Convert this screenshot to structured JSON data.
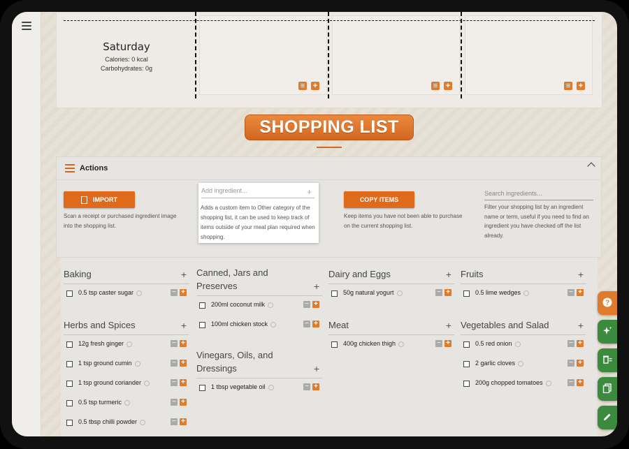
{
  "planner": {
    "day_name": "Saturday",
    "calories": "Calories: 0 kcal",
    "carbs": "Carbohydrates: 0g"
  },
  "title": "SHOPPING LIST",
  "actions": {
    "label": "Actions",
    "import_label": "IMPORT",
    "import_help": "Scan a receipt or purchased ingredient image into the shopping list.",
    "add_placeholder": "Add ingredient...",
    "add_help": "Adds a custom item to Other category of the shopping list, it can be used to keep track of items outside of your meal plan required when shopping.",
    "copy_label": "COPY ITEMS",
    "copy_help": "Keep items you have not been able to purchase on the current shopping list.",
    "search_placeholder": "Search ingredients...",
    "search_help": "Filter your shopping list by an ingredient name or term, useful if you need to find an ingredient you have checked off the list already."
  },
  "categories": [
    {
      "title": "Baking",
      "items": [
        "0.5 tsp caster sugar"
      ]
    },
    {
      "title": "Canned, Jars and Preserves",
      "items": [
        "200ml coconut milk",
        "100ml chicken stock"
      ]
    },
    {
      "title": "Dairy and Eggs",
      "items": [
        "50g natural yogurt"
      ]
    },
    {
      "title": "Fruits",
      "items": [
        "0.5 lime wedges"
      ]
    },
    {
      "title": "Herbs and Spices",
      "items": [
        "12g fresh ginger",
        "1 tsp ground cumin",
        "1 tsp ground coriander",
        "0.5 tsp turmeric",
        "0.5 tbsp chilli powder"
      ]
    },
    {
      "title": "Vinegars, Oils, and Dressings",
      "items": [
        "1 tbsp vegetable oil"
      ]
    },
    {
      "title": "Meat",
      "items": [
        "400g chicken thigh"
      ]
    },
    {
      "title": "Vegetables and Salad",
      "items": [
        "0.5 red onion",
        "2 garlic cloves",
        "200g chopped tomatoes"
      ]
    }
  ],
  "colors": {
    "accent": "#e06a1c",
    "fab_help": "#e07b2b",
    "fab_green": "#3b8a3e"
  },
  "fab_icons": [
    "help-icon",
    "sparkle-icon",
    "clear-list-icon",
    "copy-icon",
    "edit-icon"
  ]
}
